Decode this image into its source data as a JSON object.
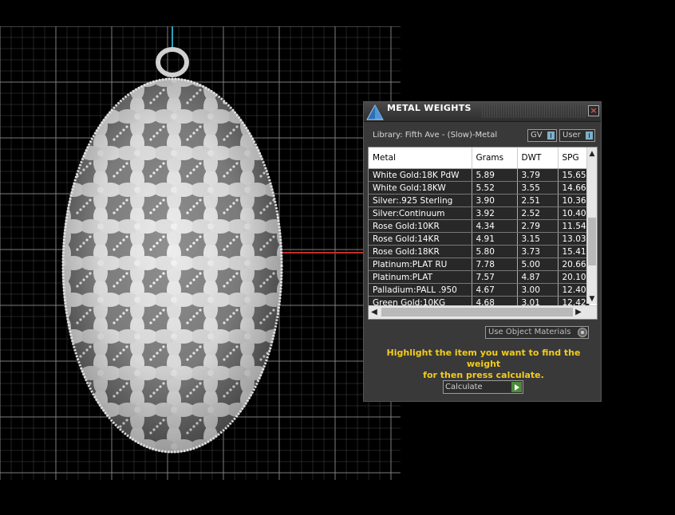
{
  "panel": {
    "title": "METAL WEIGHTS",
    "close_label": "×",
    "library_label": "Library: Fifth Ave - (Slow)-Metal",
    "gv_label": "GV",
    "user_label": "User",
    "use_object_materials_label": "Use Object Materials",
    "hint_line1": "Highlight the item you want to find the weight",
    "hint_line2": "for then press calculate.",
    "calculate_label": "Calculate"
  },
  "table": {
    "headers": [
      "Metal",
      "Grams",
      "DWT",
      "SPG"
    ],
    "rows": [
      [
        "White Gold:18K PdW",
        "5.89",
        "3.79",
        "15.65"
      ],
      [
        "White Gold:18KW",
        "5.52",
        "3.55",
        "14.66"
      ],
      [
        "Silver:.925 Sterling",
        "3.90",
        "2.51",
        "10.36"
      ],
      [
        "Silver:Continuum",
        "3.92",
        "2.52",
        "10.40"
      ],
      [
        "Rose Gold:10KR",
        "4.34",
        "2.79",
        "11.54"
      ],
      [
        "Rose Gold:14KR",
        "4.91",
        "3.15",
        "13.03"
      ],
      [
        "Rose Gold:18KR",
        "5.80",
        "3.73",
        "15.41"
      ],
      [
        "Platinum:PLAT RU",
        "7.78",
        "5.00",
        "20.66"
      ],
      [
        "Platinum:PLAT",
        "7.57",
        "4.87",
        "20.10"
      ],
      [
        "Palladium:PALL .950",
        "4.67",
        "3.00",
        "12.40"
      ],
      [
        "Green Gold:10KG",
        "4.68",
        "3.01",
        "12.42"
      ]
    ]
  },
  "colors": {
    "hint_text": "#f2cc1c",
    "grid_line": "#8a8a8a",
    "axis_x": "#c0302a",
    "axis_y": "#2ea0c0"
  },
  "icons": {
    "app": "pyramid-logo-icon",
    "close": "close-icon",
    "calculate": "play-icon"
  }
}
